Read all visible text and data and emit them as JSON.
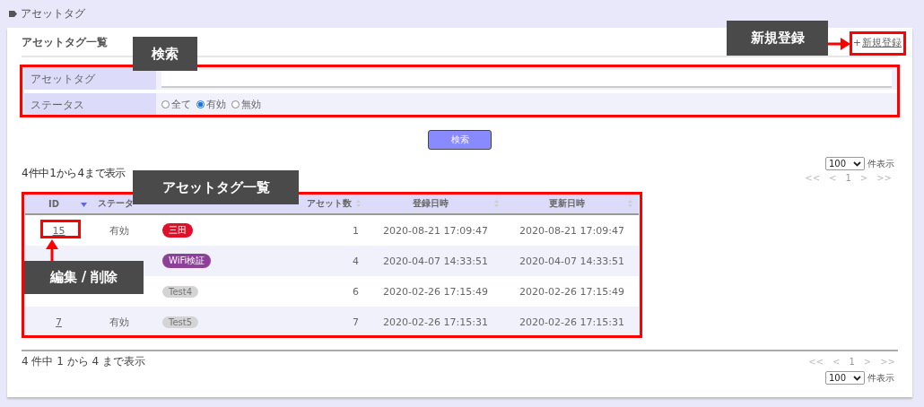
{
  "breadcrumb": "アセットタグ",
  "card": {
    "title": "アセットタグ一覧",
    "new_link": {
      "plus": "+",
      "label": "新規登録"
    }
  },
  "search": {
    "fields": [
      {
        "kind": "text",
        "label": "アセットタグ"
      },
      {
        "kind": "radio",
        "label": "ステータス",
        "options": [
          {
            "label": "全て",
            "selected": false
          },
          {
            "label": "有効",
            "selected": true
          },
          {
            "label": "無効",
            "selected": false
          }
        ]
      }
    ],
    "button": "検索"
  },
  "top_bar": {
    "page_size": "100",
    "page_size_suffix": "件表示",
    "summary": "4 件中 1 から 4 まで表示",
    "pager": [
      "<<",
      "<",
      "1",
      ">",
      ">>"
    ]
  },
  "table": {
    "columns": [
      {
        "label": "ID",
        "sorted": true
      },
      {
        "label": "ステータ"
      },
      {
        "label": "アセット数",
        "sorted": false
      },
      {
        "label": "登録日時",
        "sorted": false
      },
      {
        "label": "更新日時",
        "sorted": false
      }
    ],
    "rows": [
      {
        "id": "15",
        "status": "有効",
        "tag": {
          "label": "三田",
          "color": "#e0102a"
        },
        "count": "1",
        "created": "2020-08-21 17:09:47",
        "updated": "2020-08-21 17:09:47"
      },
      {
        "tag": {
          "label": "WiFi検証",
          "color": "#8e3f9a"
        },
        "count": "4",
        "created": "2020-04-07 14:33:51",
        "updated": "2020-04-07 14:33:51"
      },
      {
        "tag": {
          "label": "Test4",
          "color": "#d4d4d4"
        },
        "count": "6",
        "created": "2020-02-26 17:15:49",
        "updated": "2020-02-26 17:15:49"
      },
      {
        "id": "7",
        "status": "有効",
        "tag": {
          "label": "Test5",
          "color": "#d4d4d4"
        },
        "count": "7",
        "created": "2020-02-26 17:15:31",
        "updated": "2020-02-26 17:15:31"
      }
    ]
  },
  "bottom_bar": {
    "summary": "4 件中 1 から 4 まで表示",
    "pager": [
      "<<",
      "<",
      "1",
      ">",
      ">>"
    ],
    "page_size": "100",
    "page_size_suffix": "件表示"
  },
  "annotations": [
    {
      "text": "検索"
    },
    {
      "text": "新規登録"
    },
    {
      "text": "アセットタグ一覧"
    },
    {
      "text": "編集 / 削除"
    }
  ]
}
